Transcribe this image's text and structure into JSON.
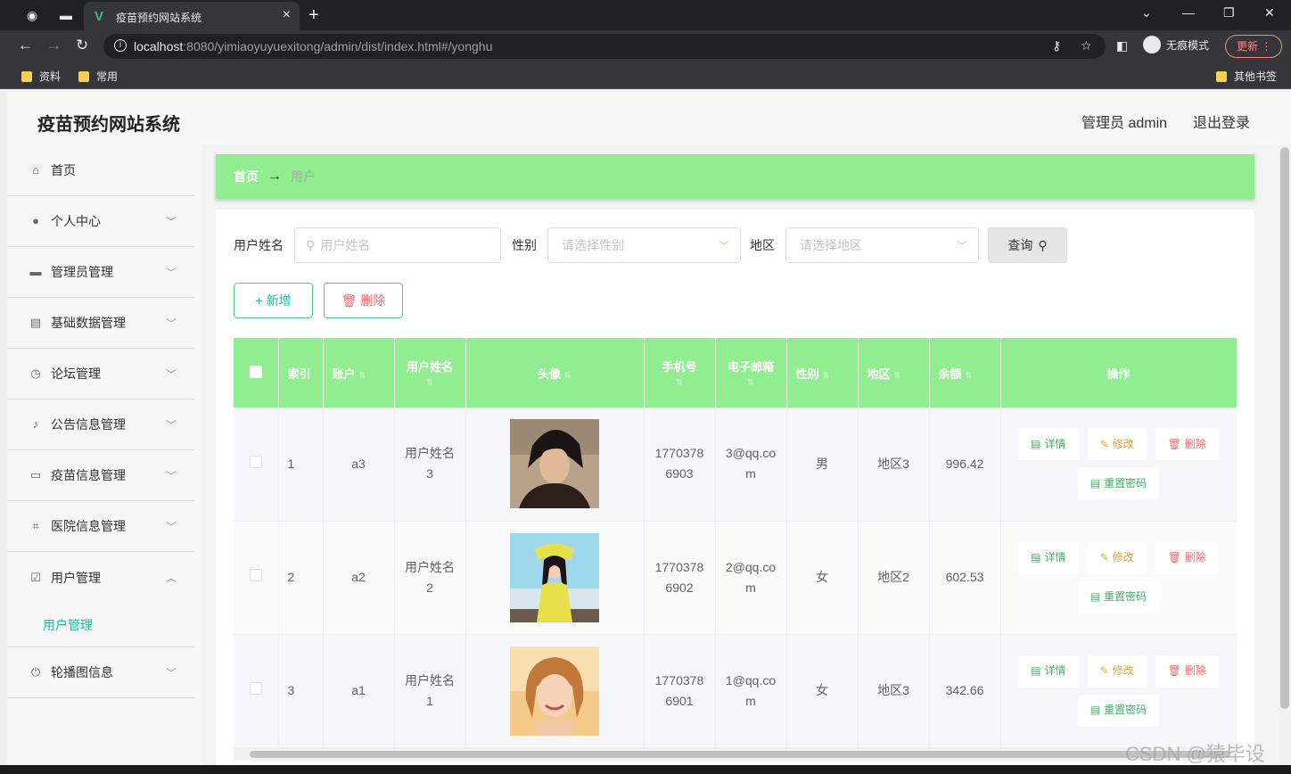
{
  "browser": {
    "tab_title": "疫苗预约网站系统",
    "url_host": "localhost",
    "url_rest": ":8080/yimiaoyuyuexitong/admin/dist/index.html#/yonghu",
    "incognito_label": "无痕模式",
    "update_label": "更新",
    "bookmarks": [
      "资料",
      "常用"
    ],
    "other_bookmarks": "其他书签"
  },
  "header": {
    "title": "疫苗预约网站系统",
    "admin_label": "管理员 admin",
    "logout_label": "退出登录"
  },
  "sidebar": {
    "items": [
      {
        "label": "首页",
        "icon": "home-icon"
      },
      {
        "label": "个人中心",
        "icon": "user-icon"
      },
      {
        "label": "管理员管理",
        "icon": "briefcase-icon"
      },
      {
        "label": "基础数据管理",
        "icon": "clipboard-icon"
      },
      {
        "label": "论坛管理",
        "icon": "clock-icon"
      },
      {
        "label": "公告信息管理",
        "icon": "microphone-icon"
      },
      {
        "label": "疫苗信息管理",
        "icon": "monitor-icon"
      },
      {
        "label": "医院信息管理",
        "icon": "crop-icon"
      },
      {
        "label": "用户管理",
        "icon": "checklist-icon"
      },
      {
        "label": "轮播图信息",
        "icon": "power-icon"
      }
    ],
    "submenu_label": "用户管理"
  },
  "breadcrumb": {
    "home": "首页",
    "current": "用户"
  },
  "search": {
    "name_label": "用户姓名",
    "name_placeholder": "用户姓名",
    "gender_label": "性别",
    "gender_placeholder": "请选择性别",
    "region_label": "地区",
    "region_placeholder": "请选择地区",
    "query_label": "查询"
  },
  "actions": {
    "add_label": "新增",
    "delete_label": "删除"
  },
  "table": {
    "headers": [
      "索引",
      "账户",
      "用户姓名",
      "头像",
      "手机号",
      "电子邮箱",
      "性别",
      "地区",
      "余额",
      "操作"
    ],
    "rows": [
      {
        "index": "1",
        "account": "a3",
        "name": "用户姓名3",
        "phone": "17703786903",
        "email": "3@qq.com",
        "gender": "男",
        "region": "地区3",
        "balance": "996.42"
      },
      {
        "index": "2",
        "account": "a2",
        "name": "用户姓名2",
        "phone": "17703786902",
        "email": "2@qq.com",
        "gender": "女",
        "region": "地区2",
        "balance": "602.53"
      },
      {
        "index": "3",
        "account": "a1",
        "name": "用户姓名1",
        "phone": "17703786901",
        "email": "1@qq.com",
        "gender": "女",
        "region": "地区3",
        "balance": "342.66"
      }
    ],
    "ops": {
      "view": "详情",
      "edit": "修改",
      "remove": "删除",
      "reset": "重置密码"
    }
  },
  "watermark": "CSDN @猿毕设",
  "colors": {
    "accent_green": "#90ee90",
    "teal": "#1fbf9f",
    "danger": "#f56c6c",
    "warning": "#e6a23c"
  }
}
